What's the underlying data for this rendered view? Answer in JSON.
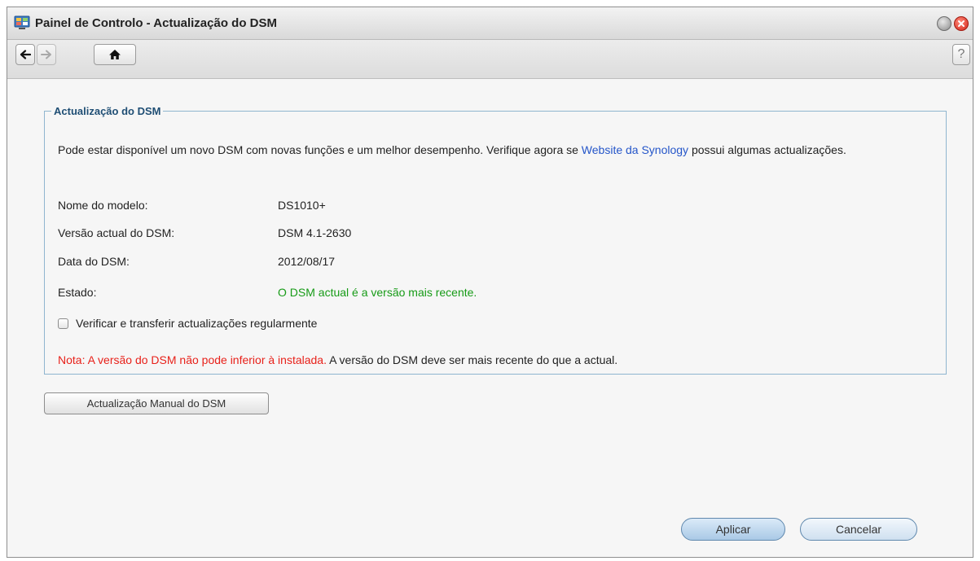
{
  "window": {
    "title": "Painel de Controlo - Actualização do DSM"
  },
  "toolbar": {
    "back_icon": "back-arrow-icon",
    "forward_icon": "forward-arrow-icon",
    "home_icon": "home-icon",
    "help_label": "?"
  },
  "panel": {
    "legend": "Actualização do DSM",
    "description_pre": "Pode estar disponível um novo DSM com novas funções e um melhor desempenho. Verifique agora se ",
    "description_link": "Website da Synology",
    "description_post": " possui algumas actualizações.",
    "rows": [
      {
        "label": "Nome do modelo:",
        "value": "DS1010+"
      },
      {
        "label": "Versão actual do DSM:",
        "value": "DSM 4.1-2630"
      },
      {
        "label": "Data do DSM:",
        "value": "2012/08/17"
      },
      {
        "label": "Estado:",
        "value": "O DSM actual é a versão mais recente."
      }
    ],
    "checkbox_label": "Verificar e transferir actualizações regularmente",
    "checkbox_checked": false,
    "note_red": "Nota: A versão do DSM não pode inferior à instalada.",
    "note_rest": " A versão do DSM deve ser mais recente do que a actual."
  },
  "buttons": {
    "manual_update": "Actualização Manual do DSM",
    "apply": "Aplicar",
    "cancel": "Cancelar"
  },
  "colors": {
    "status_ok": "#179b17",
    "note_warning": "#e8211a",
    "link": "#2556c9",
    "accent": "#1f4e74"
  }
}
